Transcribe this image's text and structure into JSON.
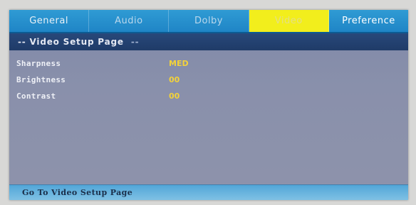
{
  "tabs": [
    {
      "label": "General"
    },
    {
      "label": "Audio"
    },
    {
      "label": "Dolby"
    },
    {
      "label": "Video"
    },
    {
      "label": "Preference"
    }
  ],
  "page_header": {
    "title": "-- Video Setup Page",
    "tail": "--"
  },
  "settings": [
    {
      "label": "Sharpness",
      "value": "MED"
    },
    {
      "label": "Brightness",
      "value": "00"
    },
    {
      "label": "Contrast",
      "value": "00"
    }
  ],
  "status_text": "Go To Video Setup Page",
  "colors": {
    "tab_bar": "#1f85c6",
    "active_tab": "#f2ee1c",
    "header_bar": "#1f3b68",
    "panel": "#8990ab",
    "value_text": "#f3d23a",
    "status_bar": "#6ab5e0"
  }
}
